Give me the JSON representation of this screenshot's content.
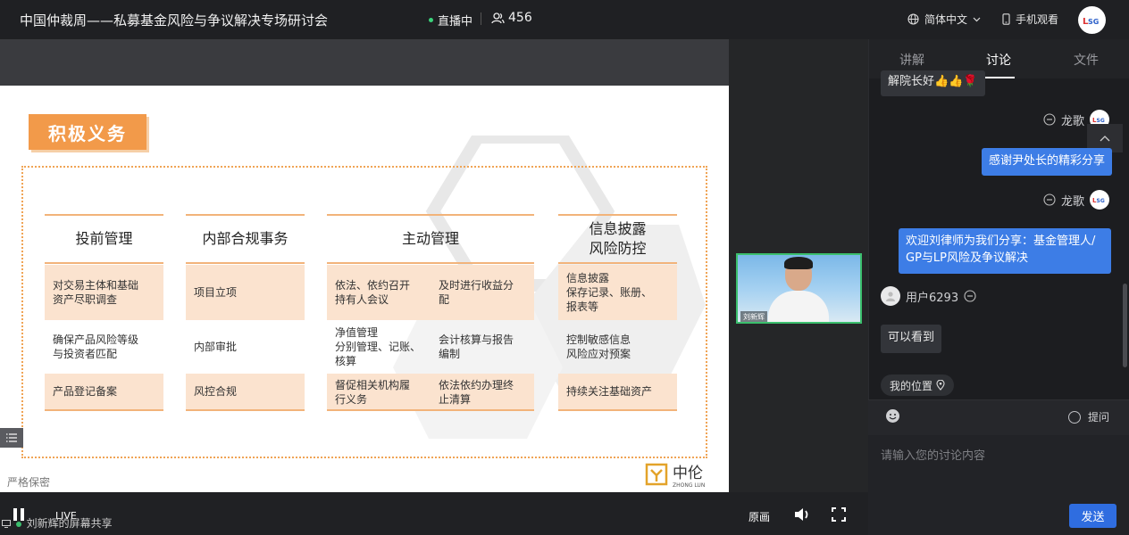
{
  "header": {
    "title": "中国仲裁周——私募基金风险与争议解决专场研讨会",
    "live_status": "直播中",
    "viewer_count": "456",
    "language": "简体中文",
    "mobile_view": "手机观看"
  },
  "slide": {
    "heading": "积极义务",
    "columns": [
      {
        "title": "投前管理",
        "cells": [
          "对交易主体和基础\n资产尽职调查",
          "确保产品风险等级\n与投资者匹配",
          "产品登记备案"
        ]
      },
      {
        "title": "内部合规事务",
        "cells": [
          "项目立项",
          "内部审批",
          "风控合规"
        ]
      },
      {
        "title": "主动管理",
        "cells": [
          "依法、依约召开\n持有人会议",
          "及时进行收益分\n配",
          "净值管理\n分别管理、记账、\n核算",
          "会计核算与报告\n编制",
          "督促相关机构履\n行义务",
          "依法依约办理终\n止清算"
        ]
      },
      {
        "title": "信息披露\n风险防控",
        "cells": [
          "信息披露\n保存记录、账册、\n报表等",
          "控制敏感信息\n风险应对预案",
          "持续关注基础资产"
        ]
      }
    ],
    "confidential": "严格保密",
    "logo_main": "中伦",
    "logo_sub": "ZHONG LUN"
  },
  "camera": {
    "name": "刘新辉"
  },
  "player": {
    "live_label": "LIVE",
    "screen_share": "刘新辉的屏幕共享",
    "quality": "原画"
  },
  "panel": {
    "tabs": [
      "讲解",
      "讨论",
      "文件"
    ],
    "active_tab": "讨论",
    "messages": [
      {
        "sender": "",
        "text": "解院长好👍👍🌹",
        "side": "left"
      },
      {
        "sender": "龙歌",
        "text": "感谢尹处长的精彩分享",
        "side": "right"
      },
      {
        "sender": "龙歌",
        "text": "欢迎刘律师为我们分享：基金管理人/\nGP与LP风险及争议解决",
        "side": "right"
      },
      {
        "sender": "用户6293",
        "text": "可以看到",
        "side": "left"
      }
    ],
    "location": "我的位置",
    "ask": "提问",
    "input_placeholder": "请输入您的讨论内容",
    "send": "发送"
  },
  "colors": {
    "accent": "#f29a4a",
    "chat_blue": "#3d7de6",
    "send_blue": "#2f6de0"
  }
}
